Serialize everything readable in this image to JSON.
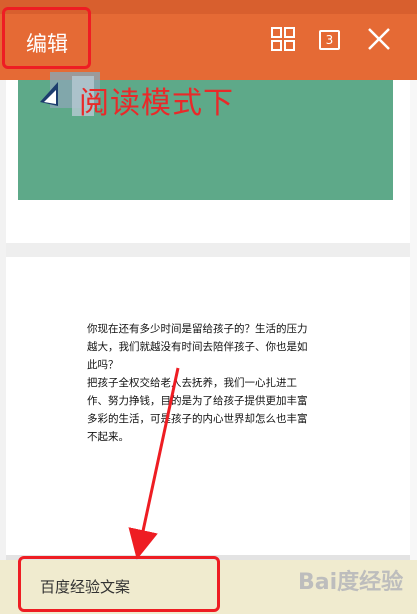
{
  "toolbar": {
    "edit_label": "编辑",
    "tab_count": "3"
  },
  "slide": {
    "caption": "阅读模式下"
  },
  "document": {
    "paragraphs": [
      "你现在还有多少时间是留给孩子的？生活的压力越大，我们就越没有时间去陪伴孩子、你也是如此吗？",
      "把孩子全权交给老人去抚养，我们一心扎进工作、努力挣钱，目的是为了给孩子提供更加丰富多彩的生活，可是孩子的内心世界却怎么也丰富不起来。"
    ]
  },
  "bottom": {
    "doc_name": "百度经验文案"
  },
  "watermark": "Bai度经验",
  "colors": {
    "toolbar": "#e56a35",
    "slide_bg": "#5ea989",
    "highlight": "#ee1d23",
    "bottom_bg": "#f0ebcf"
  },
  "icons": [
    "grid-icon",
    "close-icon",
    "slide-logo-icon",
    "arrow-annotation"
  ]
}
